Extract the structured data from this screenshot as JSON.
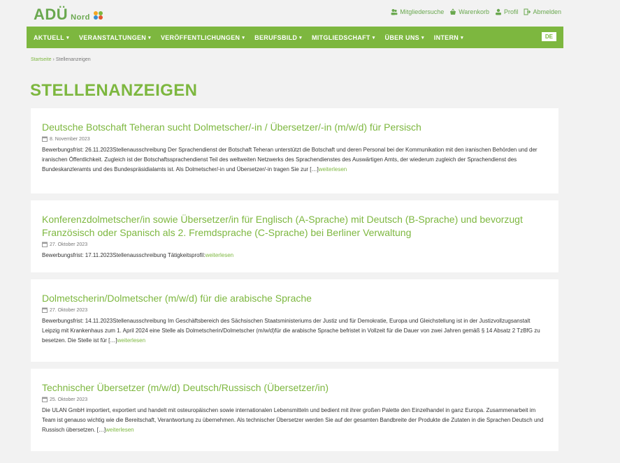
{
  "brand": {
    "logo_text": "ADÜ",
    "logo_sub": "Nord",
    "dot_colors": [
      "#f4a522",
      "#7db73f",
      "#3a8dcf",
      "#e4572e"
    ]
  },
  "util_nav": [
    {
      "label": "Mitgliedersuche",
      "icon": "members-icon"
    },
    {
      "label": "Warenkorb",
      "icon": "basket-icon"
    },
    {
      "label": "Profil",
      "icon": "profile-icon"
    },
    {
      "label": "Abmelden",
      "icon": "logout-icon"
    }
  ],
  "main_nav": [
    {
      "label": "AKTUELL"
    },
    {
      "label": "VERANSTALTUNGEN"
    },
    {
      "label": "VERÖFFENTLICHUNGEN"
    },
    {
      "label": "BERUFSBILD"
    },
    {
      "label": "MITGLIEDSCHAFT"
    },
    {
      "label": "ÜBER UNS"
    },
    {
      "label": "INTERN"
    }
  ],
  "lang": "DE",
  "breadcrumb": {
    "home": "Startseite",
    "sep": "›",
    "current": "Stellenanzeigen"
  },
  "page_title": "STELLENANZEIGEN",
  "read_more": "weiterlesen",
  "posts": [
    {
      "title": "Deutsche Botschaft Teheran sucht Dolmetscher/-in / Übersetzer/-in (m/w/d) für Persisch",
      "date": "8. November 2023",
      "excerpt": "Bewerbungsfrist: 26.11.2023Stellenausschreibung Der Sprachendienst der Botschaft Teheran unterstützt die Botschaft und deren Personal bei der Kommunikation mit den iranischen Behörden und der iranischen Öffentlichkeit. Zugleich ist der Botschaftssprachendienst Teil des weltweiten Netzwerks des Sprachendienstes des Auswärtigen Amts, der wiederum zugleich der Sprachendienst des Bundeskanzleramts und des Bundespräsidialamts ist. Als Dolmetscher/-in und Übersetzer/-in tragen Sie zur […]"
    },
    {
      "title": "Konferenzdolmetscher/in sowie Übersetzer/in für Englisch (A-Sprache) mit Deutsch (B-Sprache) und bevorzugt Französisch oder Spanisch als 2. Fremdsprache (C-Sprache) bei Berliner Verwaltung",
      "date": "27. Oktober 2023",
      "excerpt": "Bewerbungsfrist: 17.11.2023Stellenausschreibung Tätigkeitsprofil:"
    },
    {
      "title": "Dolmetscherin/Dolmetscher (m/w/d) für die arabische Sprache",
      "date": "27. Oktober 2023",
      "excerpt": "Bewerbungsfrist: 14.11.2023Stellenausschreibung Im Geschäftsbereich des Sächsischen Staatsministeriums der Justiz und für Demokratie, Europa und Gleichstellung ist in der Justizvollzugsanstalt Leipzig mit Krankenhaus zum 1. April 2024 eine Stelle als Dolmetscherin/Dolmetscher (m/w/d)für die arabische Sprache befristet in Vollzeit für die Dauer von zwei Jahren gemäß § 14 Absatz 2 TzBfG zu besetzen. Die Stelle ist für […]"
    },
    {
      "title": "Technischer Übersetzer (m/w/d) Deutsch/Russisch (Übersetzer/in)",
      "date": "25. Oktober 2023",
      "excerpt": "Die ULAN GmbH importiert, exportiert und handelt mit osteuropäischen sowie internationalen Lebensmitteln und bedient mit ihrer großen Palette den Einzelhandel in ganz Europa. Zusammenarbeit im Team ist genauso wichtig wie die Bereitschaft, Verantwortung zu übernehmen. Als technischer Übersetzer werden Sie auf der gesamten Bandbreite der Produkte die Zutaten in die Sprachen Deutsch und Russisch übersetzen. […]"
    }
  ]
}
